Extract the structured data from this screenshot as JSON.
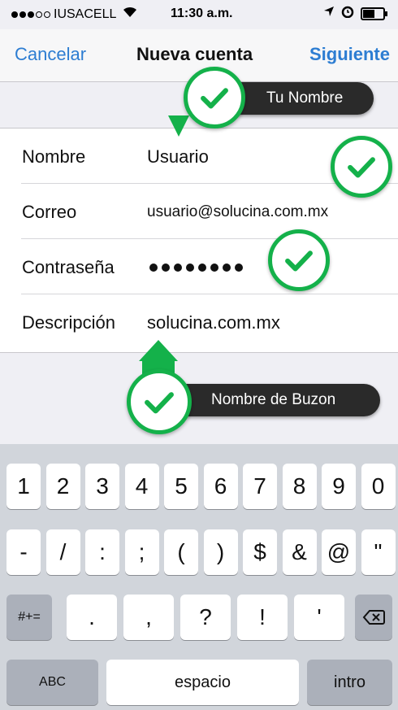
{
  "status": {
    "carrier": "IUSACELL",
    "time": "11:30 a.m."
  },
  "nav": {
    "cancel": "Cancelar",
    "title": "Nueva cuenta",
    "next": "Siguiente"
  },
  "form": {
    "name_label": "Nombre",
    "name_value": "Usuario",
    "email_label": "Correo",
    "email_value": "usuario@solucina.com.mx",
    "password_label": "Contraseña",
    "password_dots": 8,
    "description_label": "Descripción",
    "description_value": "solucina.com.mx"
  },
  "annotations": {
    "name_callout": "Tu Nombre",
    "mailbox_callout": "Nombre de Buzon"
  },
  "keyboard": {
    "row1": [
      "1",
      "2",
      "3",
      "4",
      "5",
      "6",
      "7",
      "8",
      "9",
      "0"
    ],
    "row2": [
      "-",
      "/",
      ":",
      ";",
      "(",
      ")",
      "$",
      "&",
      "@",
      "\""
    ],
    "row3_left": "#+=",
    "row3": [
      ".",
      ",",
      "?",
      "!",
      "'"
    ],
    "abc": "ABC",
    "space": "espacio",
    "return": "intro"
  },
  "colors": {
    "accent": "#2d7dd2",
    "check": "#14b14a"
  }
}
